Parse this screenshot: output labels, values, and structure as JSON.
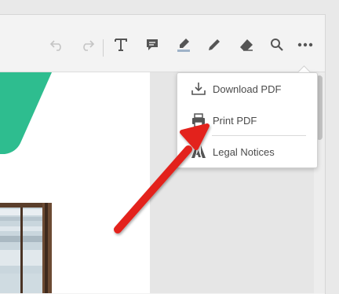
{
  "toolbar": {
    "buttons": [
      {
        "name": "undo-icon"
      },
      {
        "name": "redo-icon"
      },
      {
        "name": "text-tool-icon"
      },
      {
        "name": "comment-icon"
      },
      {
        "name": "highlight-icon"
      },
      {
        "name": "pencil-icon"
      },
      {
        "name": "eraser-icon"
      },
      {
        "name": "search-icon"
      },
      {
        "name": "more-options-icon"
      }
    ]
  },
  "menu": {
    "items": [
      {
        "label": "Download PDF",
        "icon": "download-icon"
      },
      {
        "label": "Print PDF",
        "icon": "printer-icon"
      },
      {
        "label": "Legal Notices",
        "icon": "adobe-logo-icon"
      }
    ]
  },
  "colors": {
    "accent_green": "#2ebd8f",
    "annotation_arrow": "#e3231b",
    "toolbar_icon": "#555555",
    "disabled_icon": "#c4c4c4"
  }
}
